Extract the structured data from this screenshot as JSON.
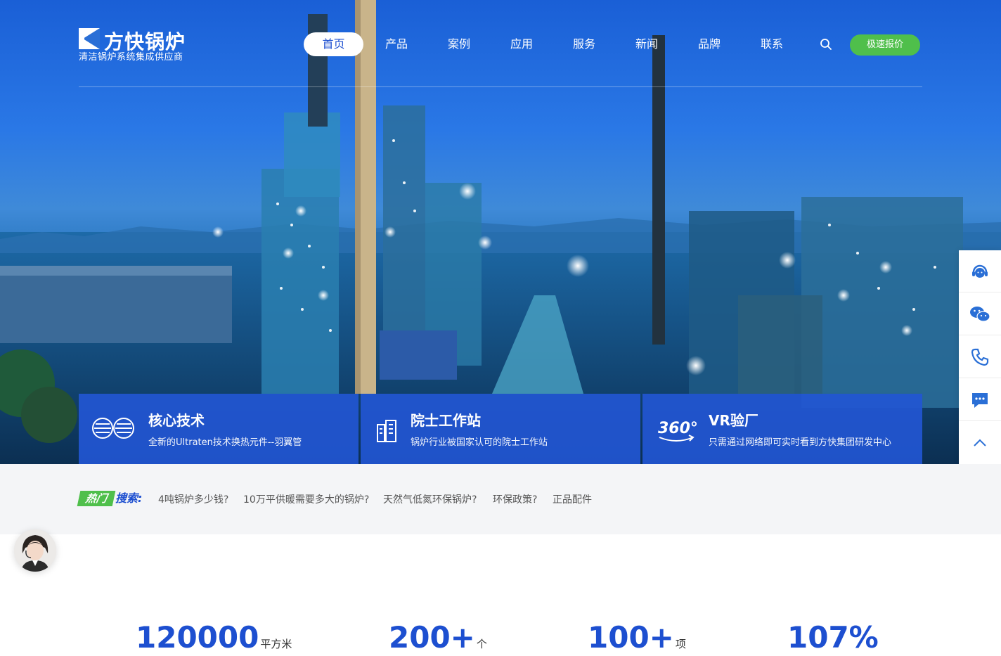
{
  "brand": {
    "name": "方快锅炉",
    "slogan": "清洁锅炉系统集成供应商"
  },
  "nav": {
    "items": [
      "首页",
      "产品",
      "案例",
      "应用",
      "服务",
      "新闻",
      "品牌",
      "联系"
    ],
    "active_index": 0,
    "quote_label": "极速报价"
  },
  "features": [
    {
      "title": "核心技术",
      "desc": "全新的Ultraten技术换热元件--羽翼管",
      "icon": "fin-tube-icon"
    },
    {
      "title": "院士工作站",
      "desc": "锅炉行业被国家认可的院士工作站",
      "icon": "building-icon"
    },
    {
      "title": "VR验厂",
      "desc": "只需通过网络即可实时看到方快集团研发中心",
      "icon": "vr-360-icon"
    }
  ],
  "sidebar": {
    "items": [
      "customer-service-icon",
      "wechat-icon",
      "phone-icon",
      "message-icon",
      "back-to-top-icon"
    ]
  },
  "hot_search": {
    "label_highlight": "热门",
    "label_rest": "搜索:",
    "links": [
      "4吨锅炉多少钱?",
      "10万平供暖需要多大的锅炉?",
      "天然气低氮环保锅炉?",
      "环保政策?",
      "正品配件"
    ]
  },
  "stats": [
    {
      "value": "120000",
      "suffix": "",
      "unit": "平方米"
    },
    {
      "value": "200",
      "suffix": "+",
      "unit": "个"
    },
    {
      "value": "100",
      "suffix": "+",
      "unit": "项"
    },
    {
      "value": "107%",
      "suffix": "",
      "unit": ""
    }
  ],
  "colors": {
    "brand_blue": "#1d4fd0",
    "feature_bg": "#2256d2",
    "quote_green": "#4fbf4b",
    "hotbar_bg": "#f4f5f7"
  }
}
